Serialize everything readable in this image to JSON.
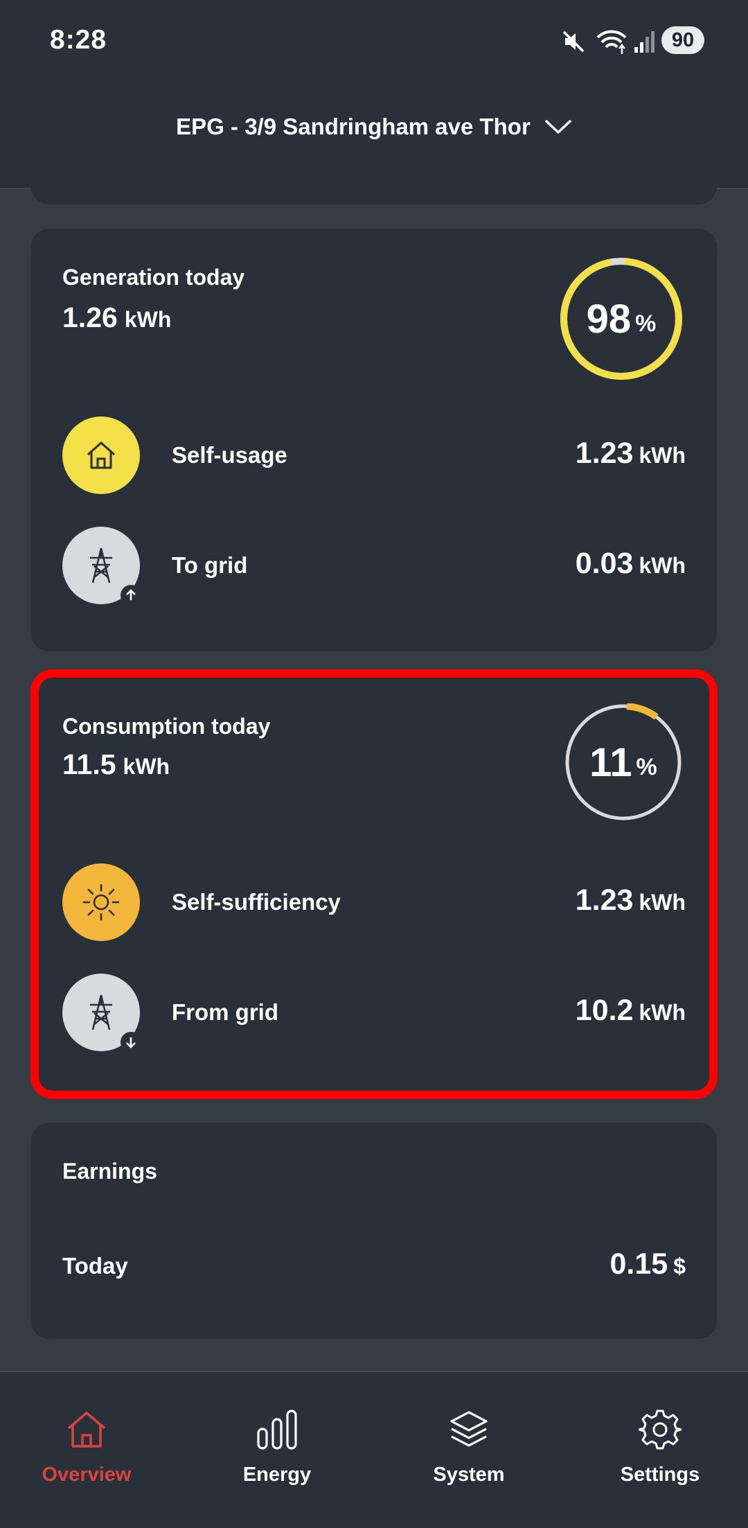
{
  "status_bar": {
    "time": "8:28",
    "battery": "90"
  },
  "header": {
    "site_name": "EPG - 3/9 Sandringham ave Thor"
  },
  "generation": {
    "title": "Generation today",
    "total_value": "1.26",
    "total_unit": "kWh",
    "percent": "98",
    "percent_symbol": "%",
    "ring_fraction": 0.98,
    "rows": [
      {
        "label": "Self-usage",
        "value": "1.23",
        "unit": "kWh",
        "icon": "house-icon"
      },
      {
        "label": "To grid",
        "value": "0.03",
        "unit": "kWh",
        "icon": "power-tower-icon"
      }
    ]
  },
  "consumption": {
    "title": "Consumption today",
    "total_value": "11.5",
    "total_unit": "kWh",
    "percent": "11",
    "percent_symbol": "%",
    "ring_fraction": 0.11,
    "rows": [
      {
        "label": "Self-sufficiency",
        "value": "1.23",
        "unit": "kWh",
        "icon": "sun-icon"
      },
      {
        "label": "From grid",
        "value": "10.2",
        "unit": "kWh",
        "icon": "power-tower-icon"
      }
    ]
  },
  "earnings": {
    "title": "Earnings",
    "row_label": "Today",
    "value": "0.15",
    "unit": "$"
  },
  "nav": [
    {
      "label": "Overview",
      "icon": "home-icon",
      "active": true
    },
    {
      "label": "Energy",
      "icon": "bar-chart-icon",
      "active": false
    },
    {
      "label": "System",
      "icon": "layers-icon",
      "active": false
    },
    {
      "label": "Settings",
      "icon": "gear-icon",
      "active": false
    }
  ],
  "colors": {
    "background": "#363c44",
    "card": "#2a3039",
    "generation_ring": "#f3df48",
    "consumption_ring": "#f2b63a",
    "ring_track": "#d8dadd",
    "nav_active": "#d9453e",
    "highlight": "#ff0000"
  }
}
